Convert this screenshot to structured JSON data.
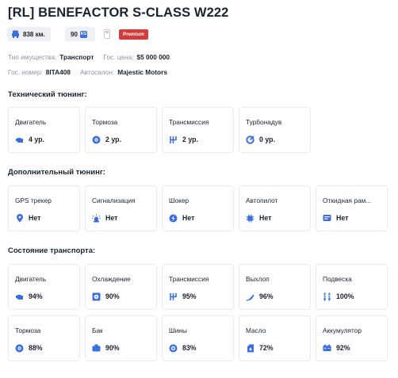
{
  "vehicle": {
    "title": "[RL] BENEFACTOR S-CLASS W222",
    "mileage": "838 км.",
    "capacity": "90",
    "capacity_unit": "KG",
    "badge": "Premium"
  },
  "info": {
    "property_type_label": "Тип имущества:",
    "property_type_value": "Транспорт",
    "gov_price_label": "Гос. цена:",
    "gov_price_value": "$5 000 000",
    "gov_number_label": "Гос. номер:",
    "gov_number_value": "8ITA408",
    "dealer_label": "Автосалон:",
    "dealer_value": "Majestic Motors"
  },
  "tech_tuning": {
    "title": "Технический тюнинг:",
    "items": [
      {
        "label": "Двигатель",
        "value": "4 ур.",
        "icon": "engine-icon"
      },
      {
        "label": "Тормоза",
        "value": "2 ур.",
        "icon": "brakes-icon"
      },
      {
        "label": "Трансмиссия",
        "value": "2 ур.",
        "icon": "gearbox-icon"
      },
      {
        "label": "Турбонадув",
        "value": "0 ур.",
        "icon": "turbo-icon"
      }
    ]
  },
  "extra_tuning": {
    "title": "Дополнительный тюнинг:",
    "items": [
      {
        "label": "GPS трекер",
        "value": "Нет",
        "icon": "gps-icon"
      },
      {
        "label": "Сигнализация",
        "value": "Нет",
        "icon": "alarm-icon"
      },
      {
        "label": "Шокер",
        "value": "Нет",
        "icon": "shocker-icon"
      },
      {
        "label": "Автопилот",
        "value": "Нет",
        "icon": "autopilot-icon"
      },
      {
        "label": "Откидная рам...",
        "value": "Нет",
        "icon": "folding-frame-icon"
      }
    ]
  },
  "condition": {
    "title": "Состояние транспорта:",
    "row1": [
      {
        "label": "Двигатель",
        "value": "94%",
        "icon": "engine-icon"
      },
      {
        "label": "Охлаждение",
        "value": "90%",
        "icon": "cooling-icon"
      },
      {
        "label": "Трансмиссия",
        "value": "95%",
        "icon": "gearbox-icon"
      },
      {
        "label": "Выхлоп",
        "value": "96%",
        "icon": "exhaust-icon"
      },
      {
        "label": "Подвеска",
        "value": "100%",
        "icon": "suspension-icon"
      }
    ],
    "row2": [
      {
        "label": "Тормоза",
        "value": "88%",
        "icon": "brakes-icon"
      },
      {
        "label": "Бак",
        "value": "90%",
        "icon": "fuel-tank-icon"
      },
      {
        "label": "Шины",
        "value": "83%",
        "icon": "tires-icon"
      },
      {
        "label": "Масло",
        "value": "72%",
        "icon": "oil-icon"
      },
      {
        "label": "Аккумулятор",
        "value": "92%",
        "icon": "battery-icon"
      }
    ]
  },
  "colors": {
    "accent": "#3b6fe0",
    "badge": "#d63a3a",
    "muted": "#8c93a3",
    "chip_bg": "#eef0f5"
  }
}
